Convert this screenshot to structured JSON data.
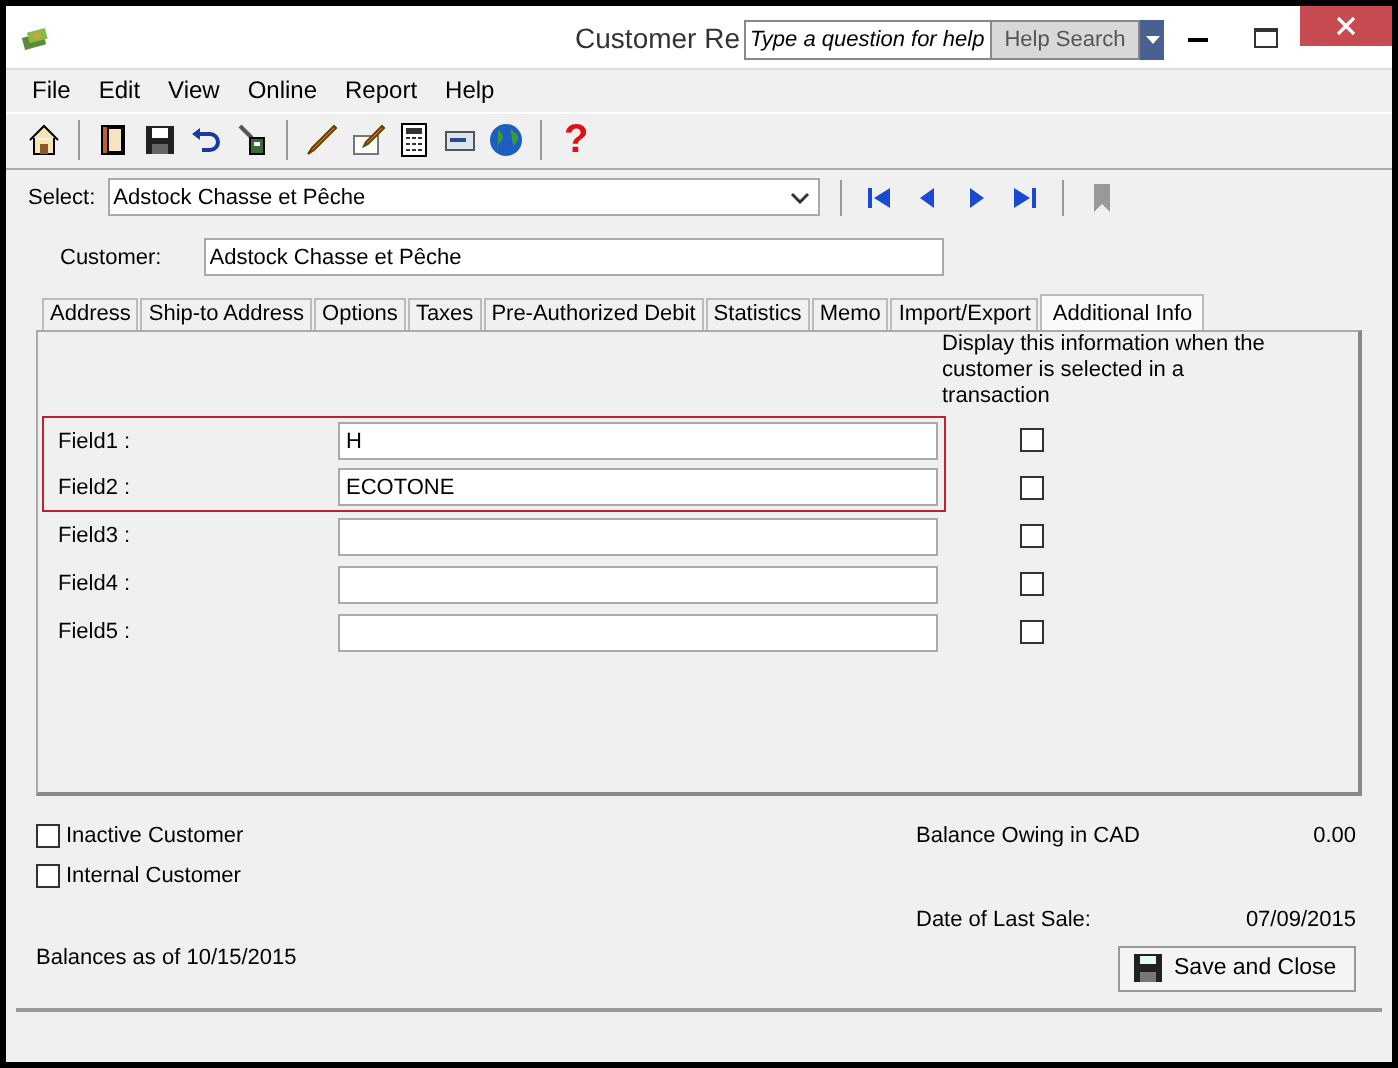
{
  "window": {
    "title": "Customer Re"
  },
  "help_search": {
    "placeholder": "Type a question for help",
    "button": "Help Search"
  },
  "menu": [
    "File",
    "Edit",
    "View",
    "Online",
    "Report",
    "Help"
  ],
  "toolbar": {
    "help_glyph": "?"
  },
  "select": {
    "label": "Select:",
    "value": "Adstock Chasse et Pêche"
  },
  "customer": {
    "label": "Customer:",
    "value": "Adstock Chasse et Pêche"
  },
  "tabs": [
    {
      "label": "Address",
      "selected": false
    },
    {
      "label": "Ship-to Address",
      "selected": false
    },
    {
      "label": "Options",
      "selected": false
    },
    {
      "label": "Taxes",
      "selected": false
    },
    {
      "label": "Pre-Authorized Debit",
      "selected": false
    },
    {
      "label": "Statistics",
      "selected": false
    },
    {
      "label": "Memo",
      "selected": false
    },
    {
      "label": "Import/Export",
      "selected": false
    },
    {
      "label": "Additional Info",
      "selected": true
    }
  ],
  "display_note": "Display this information when the customer is selected in a transaction",
  "fields": [
    {
      "label": "Field1 :",
      "value": "H",
      "display_checked": false,
      "highlighted": true
    },
    {
      "label": "Field2 :",
      "value": "ECOTONE",
      "display_checked": false,
      "highlighted": true
    },
    {
      "label": "Field3 :",
      "display_checked": false,
      "highlighted": false
    },
    {
      "label": "Field4 :",
      "display_checked": false,
      "highlighted": false
    },
    {
      "label": "Field5 :",
      "display_checked": false,
      "highlighted": false
    }
  ],
  "options": [
    {
      "label": "Inactive Customer",
      "checked": false
    },
    {
      "label": "Internal Customer",
      "checked": false
    }
  ],
  "balance": {
    "label": "Balance Owing in CAD",
    "value": "0.00"
  },
  "last_sale": {
    "label": "Date of Last Sale:",
    "value": "07/09/2015"
  },
  "balances_as_of": "Balances as of 10/15/2015",
  "save_button": "Save and Close"
}
